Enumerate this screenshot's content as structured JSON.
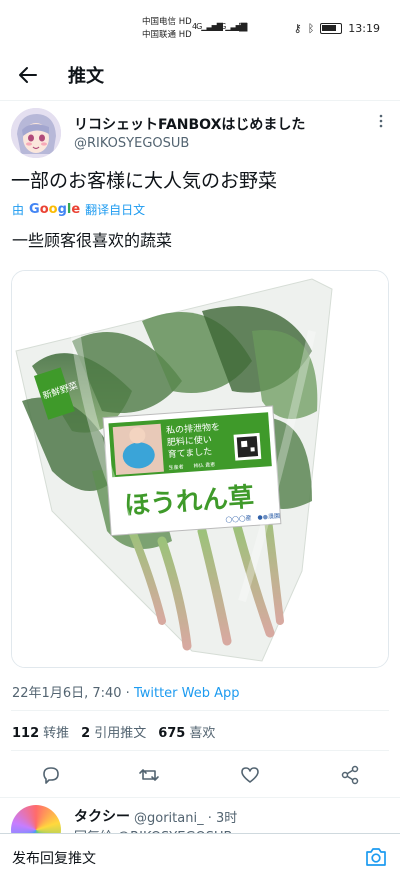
{
  "status": {
    "carrier1": "中国电信",
    "carrier2": "中国联通",
    "hd1": "HD",
    "hd2": "HD",
    "net1": "4G",
    "net2": "4G",
    "time": "13:19"
  },
  "header": {
    "title": "推文"
  },
  "tweet": {
    "author_name": "リコシェットFANBOXはじめました",
    "author_handle": "@RIKOSYEGOSUB",
    "text": "一部のお客様に大人気のお野菜",
    "translate_prefix": "由",
    "translate_brand": "Google",
    "translate_label": "翻译自日文",
    "translated_text": "一些顾客很喜欢的蔬菜",
    "timestamp": "22年1月6日, 7:40 · ",
    "source": "Twitter Web App",
    "retweets_count": "112",
    "retweets_label": "转推",
    "quotes_count": "2",
    "quotes_label": "引用推文",
    "likes_count": "675",
    "likes_label": "喜欢"
  },
  "media": {
    "side_tag": "新鮮野菜",
    "label_line1": "私の排泄物を",
    "label_line2": "肥料に使い",
    "label_line3": "育てました",
    "label_small": "生産者　　柿仏 貴恵",
    "product_name": "ほうれん草",
    "footer_mark": "◯◯◯産　●●農園"
  },
  "reply": {
    "name": "タクシー",
    "handle": "@goritani_ · 3时",
    "partial": "回复给 @RIKOSYEGOSUB"
  },
  "reply_bar": {
    "placeholder": "发布回复推文"
  },
  "colors": {
    "accent": "#1d9bf0",
    "text": "#0f1419",
    "muted": "#536471",
    "label_green": "#3f9a2a"
  },
  "icons": [
    "back-arrow-icon",
    "more-icon",
    "reply-icon",
    "retweet-icon",
    "like-icon",
    "share-icon",
    "camera-icon"
  ]
}
